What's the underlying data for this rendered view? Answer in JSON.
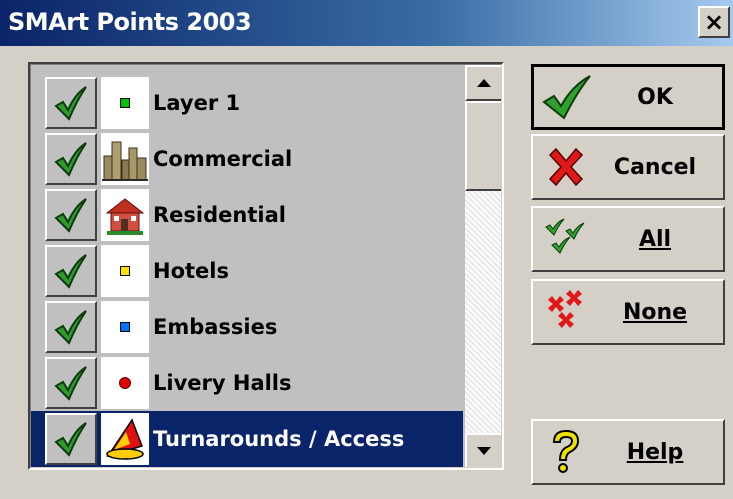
{
  "window": {
    "title": "SMArt Points 2003",
    "close_glyph": "×"
  },
  "layers": [
    {
      "label": "Layer 1",
      "checked": true,
      "icon": "green-square-icon",
      "selected": false
    },
    {
      "label": "Commercial",
      "checked": true,
      "icon": "city-buildings-icon",
      "selected": false
    },
    {
      "label": "Residential",
      "checked": true,
      "icon": "house-icon",
      "selected": false
    },
    {
      "label": "Hotels",
      "checked": true,
      "icon": "yellow-square-icon",
      "selected": false
    },
    {
      "label": "Embassies",
      "checked": true,
      "icon": "blue-square-icon",
      "selected": false
    },
    {
      "label": "Livery Halls",
      "checked": true,
      "icon": "red-dot-icon",
      "selected": false
    },
    {
      "label": "Turnarounds / Access",
      "checked": true,
      "icon": "red-cone-icon",
      "selected": true
    }
  ],
  "buttons": {
    "ok": {
      "label": "OK",
      "icon": "checkmark-icon"
    },
    "cancel": {
      "label": "Cancel",
      "icon": "red-x-icon"
    },
    "all": {
      "label": "All",
      "icon": "multi-check-icon"
    },
    "none": {
      "label": "None",
      "icon": "multi-x-icon"
    },
    "help": {
      "label": "Help",
      "icon": "question-mark-icon"
    }
  },
  "colors": {
    "selection": "#0a246a",
    "title_start": "#0a246a",
    "face": "#d4d0c8"
  }
}
